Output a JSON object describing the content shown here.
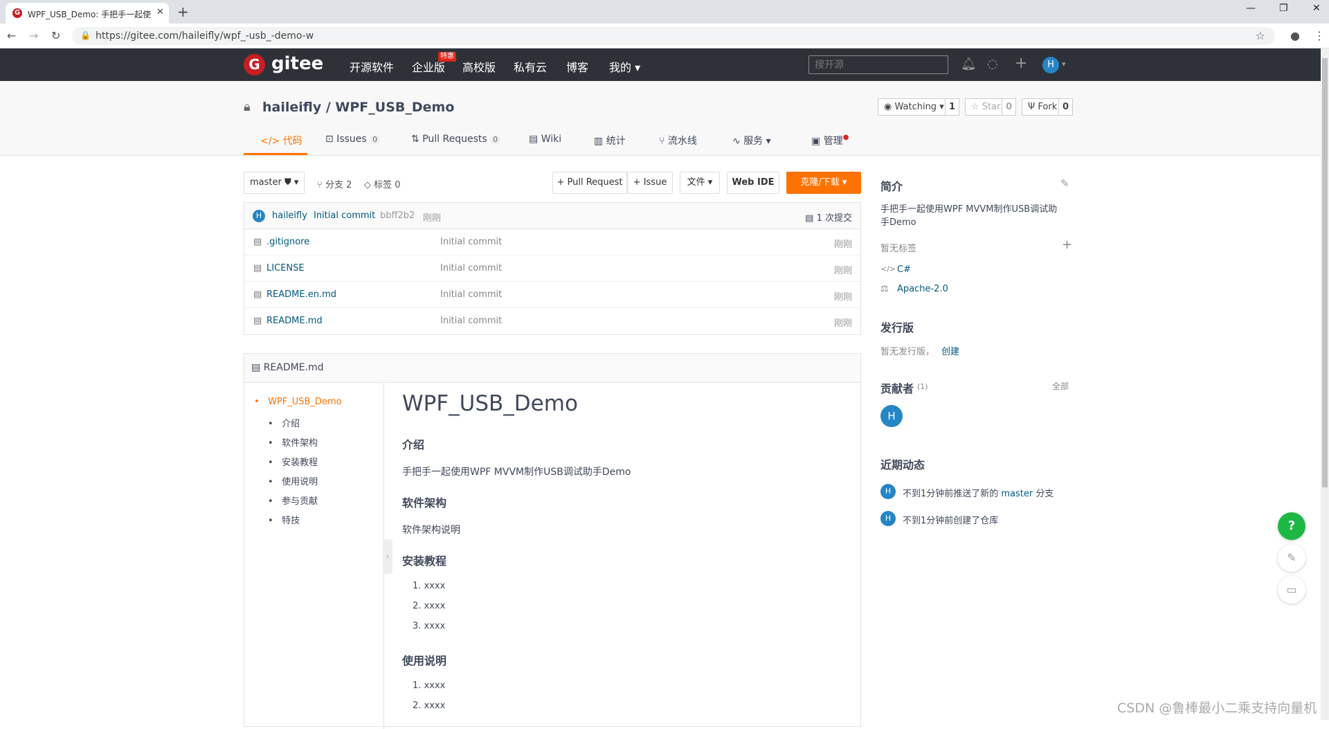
{
  "browser": {
    "tab_title": "WPF_USB_Demo: 手把手一起使",
    "tab_close": "✕",
    "new_tab": "+",
    "url": "https://gitee.com/haileifly/wpf_-usb_-demo-w",
    "win_min": "—",
    "win_restore": "❐",
    "win_close": "✕"
  },
  "header": {
    "logo_text": "gitee",
    "nav": [
      "开源软件",
      "企业版",
      "高校版",
      "私有云",
      "博客",
      "我的"
    ],
    "nav_badge": "特惠",
    "search_placeholder": "搜开源",
    "avatar_letter": "H"
  },
  "repo": {
    "title": "haileifly / WPF_USB_Demo",
    "watching_label": "Watching",
    "watching_count": "1",
    "star_label": "Star",
    "star_count": "0",
    "fork_label": "Fork",
    "fork_count": "0",
    "tabs": {
      "code": "代码",
      "issues": "Issues",
      "issues_count": "0",
      "prs": "Pull Requests",
      "prs_count": "0",
      "wiki": "Wiki",
      "stats": "统计",
      "pipeline": "流水线",
      "service": "服务",
      "manage": "管理"
    }
  },
  "toolbar": {
    "branch": "master",
    "branches": "分支 2",
    "tags": "标签 0",
    "pull_request": "+ Pull Request",
    "issue": "+ Issue",
    "file": "文件",
    "web_ide": "Web IDE",
    "clone": "克隆/下载"
  },
  "commit": {
    "avatar": "H",
    "author": "haileifly",
    "message": "Initial commit",
    "hash": "bbff2b2",
    "time": "刚刚",
    "count": "1 次提交"
  },
  "files": [
    {
      "name": ".gitignore",
      "message": "Initial commit",
      "time": "刚刚"
    },
    {
      "name": "LICENSE",
      "message": "Initial commit",
      "time": "刚刚"
    },
    {
      "name": "README.en.md",
      "message": "Initial commit",
      "time": "刚刚"
    },
    {
      "name": "README.md",
      "message": "Initial commit",
      "time": "刚刚"
    }
  ],
  "readme": {
    "filename": "README.md",
    "toc": [
      "WPF_USB_Demo",
      "介绍",
      "软件架构",
      "安装教程",
      "使用说明",
      "参与贡献",
      "特技"
    ],
    "title": "WPF_USB_Demo",
    "intro_h": "介绍",
    "intro_p": "手把手一起使用WPF MVVM制作USB调试助手Demo",
    "arch_h": "软件架构",
    "arch_p": "软件架构说明",
    "install_h": "安装教程",
    "install_items": [
      "1. xxxx",
      "2. xxxx",
      "3. xxxx"
    ],
    "usage_h": "使用说明",
    "usage_items": [
      "1. xxxx",
      "2. xxxx"
    ]
  },
  "sidebar": {
    "intro_h": "简介",
    "desc": "手把手一起使用WPF MVVM制作USB调试助手Demo",
    "desc_line1": "手把手一起使用WPF MVVM制作USB调试助",
    "desc_line2": "手Demo",
    "no_tags": "暂无标签",
    "language": "C#",
    "license": "Apache-2.0",
    "release_h": "发行版",
    "no_release": "暂无发行版，",
    "create": "创建",
    "contrib_h": "贡献者",
    "contrib_count": "(1)",
    "all": "全部",
    "contrib_avatar": "H",
    "activity_h": "近期动态",
    "activity": [
      {
        "avatar": "H",
        "text_a": "不到1分钟前推送了新的 ",
        "branch": "master",
        "text_b": " 分支"
      },
      {
        "avatar": "H",
        "text_a": "不到1分钟前创建了仓库"
      }
    ]
  },
  "watermark": "CSDN @鲁棒最小二乘支持向量机",
  "colors": {
    "header_bg": "#2e3238",
    "accent": "#fe7300",
    "link": "#005980",
    "avatar": "#2486c5",
    "help": "#1db844"
  }
}
